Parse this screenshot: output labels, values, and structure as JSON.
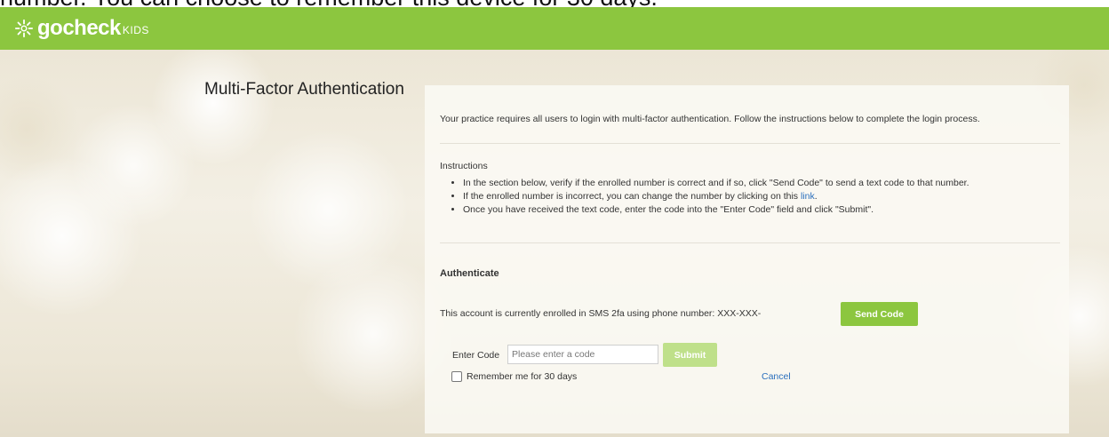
{
  "caption": "number. You can choose to remember this device for 30 days.",
  "header": {
    "brand_name": "gocheck",
    "brand_suffix": "KIDS",
    "color": "#8cc63f"
  },
  "page": {
    "title": "Multi-Factor Authentication",
    "intro": "Your practice requires all users to login with multi-factor authentication. Follow the instructions below to complete the login process."
  },
  "instructions": {
    "heading": "Instructions",
    "item1": "In the section below, verify if the enrolled number is correct and if so, click \"Send Code\" to send a text code to that number.",
    "item2_prefix": "If the enrolled number is incorrect, you can change the number by clicking on this ",
    "item2_link": "link",
    "item2_suffix": ".",
    "item3": "Once you have received the text code, enter the code into the \"Enter Code\" field and click \"Submit\"."
  },
  "authenticate": {
    "heading": "Authenticate",
    "enrolled_text": "This account is currently enrolled in SMS 2fa using phone number: XXX-XXX-",
    "send_code_label": "Send Code",
    "enter_code_label": "Enter Code",
    "code_placeholder": "Please enter a code",
    "code_value": "",
    "submit_label": "Submit",
    "remember_label": "Remember me for 30 days",
    "remember_checked": false,
    "cancel_label": "Cancel"
  },
  "colors": {
    "accent": "#8cc63f",
    "accent_disabled": "#bfe08a",
    "link": "#2a6fbd"
  }
}
